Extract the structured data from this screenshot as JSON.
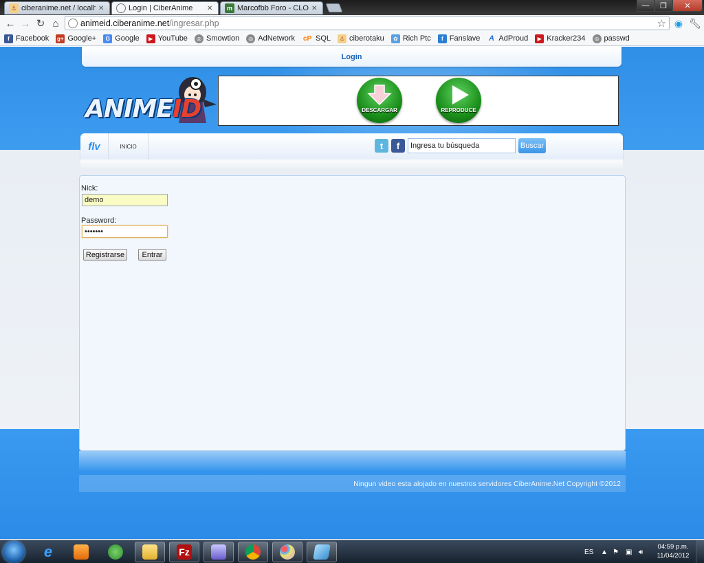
{
  "browser": {
    "tabs": [
      {
        "label": "ciberanime.net / localhost / ",
        "favicon": "pma"
      },
      {
        "label": "Login | CiberAnime",
        "favicon": "page"
      },
      {
        "label": "Marcofbb Foro - CLON ANI",
        "favicon": "m"
      }
    ],
    "url_domain": "animeid.ciberanime.net",
    "url_path": "/ingresar.php"
  },
  "bookmarks": [
    {
      "label": "Facebook",
      "color": "#3b5998",
      "glyph": "f"
    },
    {
      "label": "Google+",
      "color": "#c23b22",
      "glyph": "g+"
    },
    {
      "label": "Google",
      "color": "#4a8af4",
      "glyph": "G"
    },
    {
      "label": "YouTube",
      "color": "#cc181e",
      "glyph": "▶"
    },
    {
      "label": "Smowtion",
      "color": "#888888",
      "glyph": "◎"
    },
    {
      "label": "AdNetwork",
      "color": "#888888",
      "glyph": "◎"
    },
    {
      "label": "SQL",
      "color": "#ff7a00",
      "glyph": "cP"
    },
    {
      "label": "ciberotaku",
      "color": "#f0a000",
      "glyph": "P"
    },
    {
      "label": "Rich Ptc",
      "color": "#5aa0e0",
      "glyph": "✿"
    },
    {
      "label": "Fanslave",
      "color": "#2a7fd4",
      "glyph": "f"
    },
    {
      "label": "AdProud",
      "color": "#2a6fd4",
      "glyph": "A"
    },
    {
      "label": "Kracker234",
      "color": "#cc181e",
      "glyph": "▶"
    },
    {
      "label": "passwd",
      "color": "#888888",
      "glyph": "◎"
    }
  ],
  "site": {
    "login_link": "Login",
    "logo_text_a": "ANIME",
    "logo_text_b": "ID",
    "banner": {
      "download_label": "DESCARGAR",
      "play_label": "REPRODUCE"
    },
    "nav": {
      "flv_label": "flv",
      "home_label": "INICIO"
    },
    "search": {
      "value": "Ingresa tu búsqueda",
      "button_label": "Buscar"
    },
    "form": {
      "nick_label": "Nick:",
      "nick_value": "demo",
      "password_label": "Password:",
      "password_value": "•••••••",
      "register_label": "Registrarse",
      "submit_label": "Entrar"
    },
    "footer_text": "Ningun video esta alojado en nuestros servidores CiberAnime.Net Copyright ©2012"
  },
  "taskbar": {
    "language": "ES",
    "time": "04:59 p.m.",
    "date": "11/04/2012"
  },
  "colors": {
    "accent_blue": "#2c8fe8",
    "link_blue": "#1b63b5",
    "nick_field_bg": "#fbfbc6",
    "button_green": "#1a8f1a"
  }
}
